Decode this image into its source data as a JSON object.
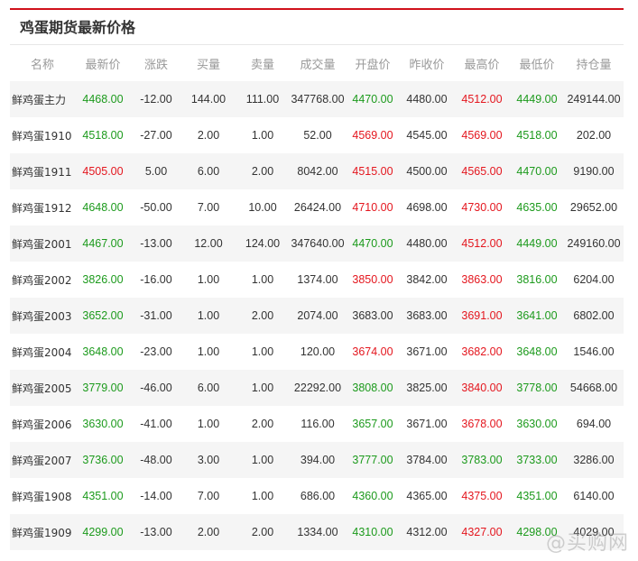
{
  "title": "鸡蛋期货最新价格",
  "columns": [
    "名称",
    "最新价",
    "涨跌",
    "买量",
    "卖量",
    "成交量",
    "开盘价",
    "昨收价",
    "最高价",
    "最低价",
    "持仓量"
  ],
  "rows": [
    {
      "name": "鲜鸡蛋主力",
      "last": "4468.00",
      "change": "-12.00",
      "bid": "144.00",
      "ask": "111.00",
      "volume": "347768.00",
      "open": "4470.00",
      "prev": "4480.00",
      "high": "4512.00",
      "low": "4449.00",
      "oi": "249144.00",
      "c": [
        "down",
        "down",
        "",
        "",
        "",
        "",
        "down",
        "",
        "up",
        "down",
        ""
      ]
    },
    {
      "name": "鲜鸡蛋1910",
      "last": "4518.00",
      "change": "-27.00",
      "bid": "2.00",
      "ask": "1.00",
      "volume": "52.00",
      "open": "4569.00",
      "prev": "4545.00",
      "high": "4569.00",
      "low": "4518.00",
      "oi": "202.00",
      "c": [
        "down",
        "down",
        "",
        "",
        "",
        "",
        "up",
        "",
        "up",
        "down",
        ""
      ]
    },
    {
      "name": "鲜鸡蛋1911",
      "last": "4505.00",
      "change": "5.00",
      "bid": "6.00",
      "ask": "2.00",
      "volume": "8042.00",
      "open": "4515.00",
      "prev": "4500.00",
      "high": "4565.00",
      "low": "4470.00",
      "oi": "9190.00",
      "c": [
        "up",
        "up",
        "",
        "",
        "",
        "",
        "up",
        "",
        "up",
        "down",
        ""
      ]
    },
    {
      "name": "鲜鸡蛋1912",
      "last": "4648.00",
      "change": "-50.00",
      "bid": "7.00",
      "ask": "10.00",
      "volume": "26424.00",
      "open": "4710.00",
      "prev": "4698.00",
      "high": "4730.00",
      "low": "4635.00",
      "oi": "29652.00",
      "c": [
        "down",
        "down",
        "",
        "",
        "",
        "",
        "up",
        "",
        "up",
        "down",
        ""
      ]
    },
    {
      "name": "鲜鸡蛋2001",
      "last": "4467.00",
      "change": "-13.00",
      "bid": "12.00",
      "ask": "124.00",
      "volume": "347640.00",
      "open": "4470.00",
      "prev": "4480.00",
      "high": "4512.00",
      "low": "4449.00",
      "oi": "249160.00",
      "c": [
        "down",
        "down",
        "",
        "",
        "",
        "",
        "down",
        "",
        "up",
        "down",
        ""
      ]
    },
    {
      "name": "鲜鸡蛋2002",
      "last": "3826.00",
      "change": "-16.00",
      "bid": "1.00",
      "ask": "1.00",
      "volume": "1374.00",
      "open": "3850.00",
      "prev": "3842.00",
      "high": "3863.00",
      "low": "3816.00",
      "oi": "6204.00",
      "c": [
        "down",
        "down",
        "",
        "",
        "",
        "",
        "up",
        "",
        "up",
        "down",
        ""
      ]
    },
    {
      "name": "鲜鸡蛋2003",
      "last": "3652.00",
      "change": "-31.00",
      "bid": "1.00",
      "ask": "2.00",
      "volume": "2074.00",
      "open": "3683.00",
      "prev": "3683.00",
      "high": "3691.00",
      "low": "3641.00",
      "oi": "6802.00",
      "c": [
        "down",
        "down",
        "",
        "",
        "",
        "",
        "",
        "",
        "up",
        "down",
        ""
      ]
    },
    {
      "name": "鲜鸡蛋2004",
      "last": "3648.00",
      "change": "-23.00",
      "bid": "1.00",
      "ask": "1.00",
      "volume": "120.00",
      "open": "3674.00",
      "prev": "3671.00",
      "high": "3682.00",
      "low": "3648.00",
      "oi": "1546.00",
      "c": [
        "down",
        "down",
        "",
        "",
        "",
        "",
        "up",
        "",
        "up",
        "down",
        ""
      ]
    },
    {
      "name": "鲜鸡蛋2005",
      "last": "3779.00",
      "change": "-46.00",
      "bid": "6.00",
      "ask": "1.00",
      "volume": "22292.00",
      "open": "3808.00",
      "prev": "3825.00",
      "high": "3840.00",
      "low": "3778.00",
      "oi": "54668.00",
      "c": [
        "down",
        "down",
        "",
        "",
        "",
        "",
        "down",
        "",
        "up",
        "down",
        ""
      ]
    },
    {
      "name": "鲜鸡蛋2006",
      "last": "3630.00",
      "change": "-41.00",
      "bid": "1.00",
      "ask": "2.00",
      "volume": "116.00",
      "open": "3657.00",
      "prev": "3671.00",
      "high": "3678.00",
      "low": "3630.00",
      "oi": "694.00",
      "c": [
        "down",
        "down",
        "",
        "",
        "",
        "",
        "down",
        "",
        "up",
        "down",
        ""
      ]
    },
    {
      "name": "鲜鸡蛋2007",
      "last": "3736.00",
      "change": "-48.00",
      "bid": "3.00",
      "ask": "1.00",
      "volume": "394.00",
      "open": "3777.00",
      "prev": "3784.00",
      "high": "3783.00",
      "low": "3733.00",
      "oi": "3286.00",
      "c": [
        "down",
        "down",
        "",
        "",
        "",
        "",
        "down",
        "",
        "down",
        "down",
        ""
      ]
    },
    {
      "name": "鲜鸡蛋1908",
      "last": "4351.00",
      "change": "-14.00",
      "bid": "7.00",
      "ask": "1.00",
      "volume": "686.00",
      "open": "4360.00",
      "prev": "4365.00",
      "high": "4375.00",
      "low": "4351.00",
      "oi": "6140.00",
      "c": [
        "down",
        "down",
        "",
        "",
        "",
        "",
        "down",
        "",
        "up",
        "down",
        ""
      ]
    },
    {
      "name": "鲜鸡蛋1909",
      "last": "4299.00",
      "change": "-13.00",
      "bid": "2.00",
      "ask": "2.00",
      "volume": "1334.00",
      "open": "4310.00",
      "prev": "4312.00",
      "high": "4327.00",
      "low": "4298.00",
      "oi": "4029.00",
      "c": [
        "down",
        "down",
        "",
        "",
        "",
        "",
        "down",
        "",
        "up",
        "down",
        ""
      ]
    }
  ],
  "watermark": "@买购网"
}
